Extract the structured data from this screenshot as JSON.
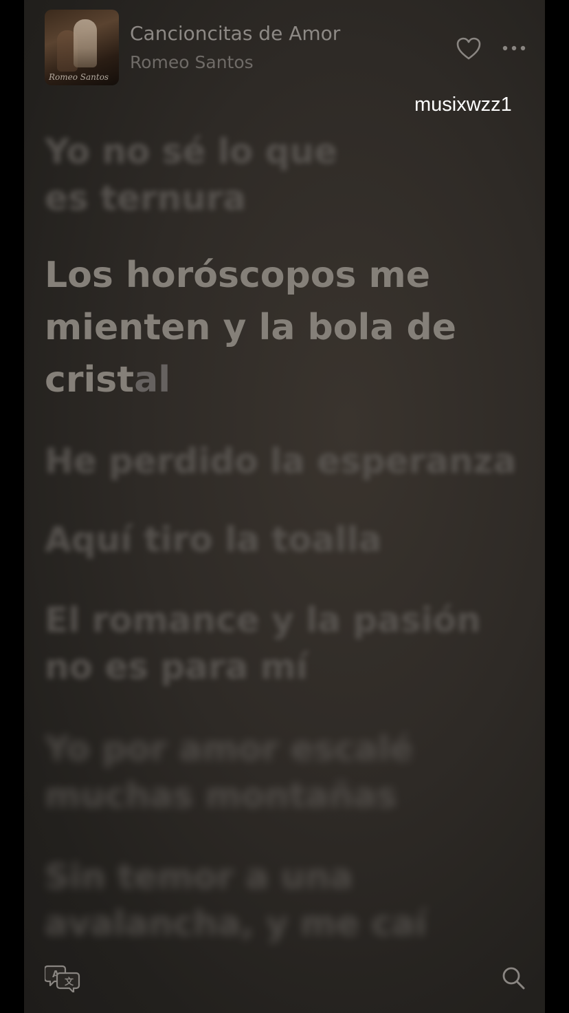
{
  "now_playing": {
    "title": "Cancioncitas de Amor",
    "artist": "Romeo Santos",
    "album_art_text": "Romeo Santos"
  },
  "watermark": "musixwzz1",
  "lyrics": {
    "previous": [
      "Yo no sé lo que",
      "es ternura"
    ],
    "current_sung": [
      "Los horóscopos me",
      "mienten y la bola de",
      "crist"
    ],
    "current_unsung": "al",
    "upcoming_1": "He perdido la esperanza",
    "upcoming_2": "Aquí tiro la toalla",
    "upcoming_3": [
      "El romance y la pasión",
      "no es para mí"
    ],
    "upcoming_4": [
      "Yo por amor escalé",
      "muchas montañas"
    ],
    "upcoming_5": [
      "Sin temor a una",
      "avalancha, y me caí"
    ]
  },
  "icons": {
    "favorite": "heart-icon",
    "more": "ellipsis-icon",
    "translate": "translate-icon",
    "search": "search-icon"
  },
  "colors": {
    "background": "#2e2a26",
    "text_active": "#858079",
    "text_dim": "#5d5955"
  }
}
